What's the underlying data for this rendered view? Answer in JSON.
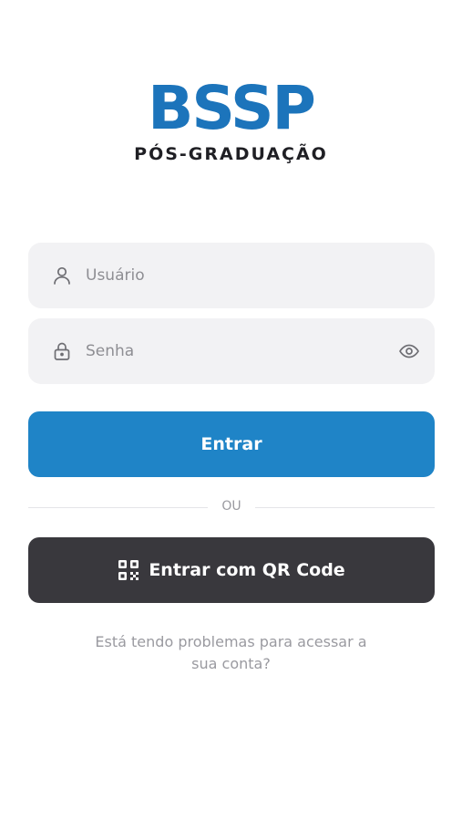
{
  "logo": {
    "brand": "BSSP",
    "subtitle": "PÓS-GRADUAÇÃO"
  },
  "login": {
    "username": {
      "placeholder": "Usuário",
      "value": "",
      "icon": "user-icon"
    },
    "password": {
      "placeholder": "Senha",
      "value": "",
      "icon": "lock-icon",
      "toggle_icon": "eye-icon"
    },
    "submit_label": "Entrar",
    "divider_text": "OU",
    "qr_label": "Entrar com QR Code",
    "qr_icon": "qr-code-icon",
    "help_text": "Está tendo problemas para acessar a sua conta?"
  },
  "colors": {
    "brand_blue": "#1c74bb",
    "primary_button": "#1f84c7",
    "dark_button": "#39383d",
    "field_background": "#f2f2f4"
  }
}
